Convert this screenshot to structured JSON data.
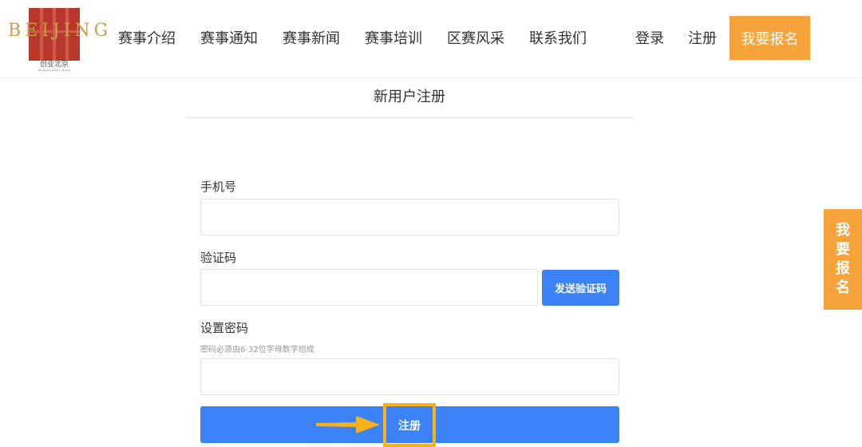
{
  "header": {
    "logo": {
      "word": "BEIJING",
      "cn": "创业北京",
      "en": "Entrepreneurship in Beijing"
    },
    "nav": [
      "赛事介绍",
      "赛事通知",
      "赛事新闻",
      "赛事培训",
      "区赛风采",
      "联系我们"
    ],
    "login": "登录",
    "register": "注册",
    "signup": "我要报名",
    "accent_color": "#f7a33b"
  },
  "page": {
    "title": "新用户注册"
  },
  "form": {
    "phone_label": "手机号",
    "phone_value": "",
    "code_label": "验证码",
    "code_value": "",
    "send_code": "发送验证码",
    "password_label": "设置密码",
    "password_hint": "密码必须由6-32位字母数字组成",
    "password_value": "",
    "submit": "注册",
    "button_color": "#3b82f6"
  },
  "side_tab": {
    "chars": [
      "我",
      "要",
      "报",
      "名"
    ]
  },
  "annotation": {
    "highlight_color": "#f5b21b",
    "icon": "arrow-right-icon"
  }
}
